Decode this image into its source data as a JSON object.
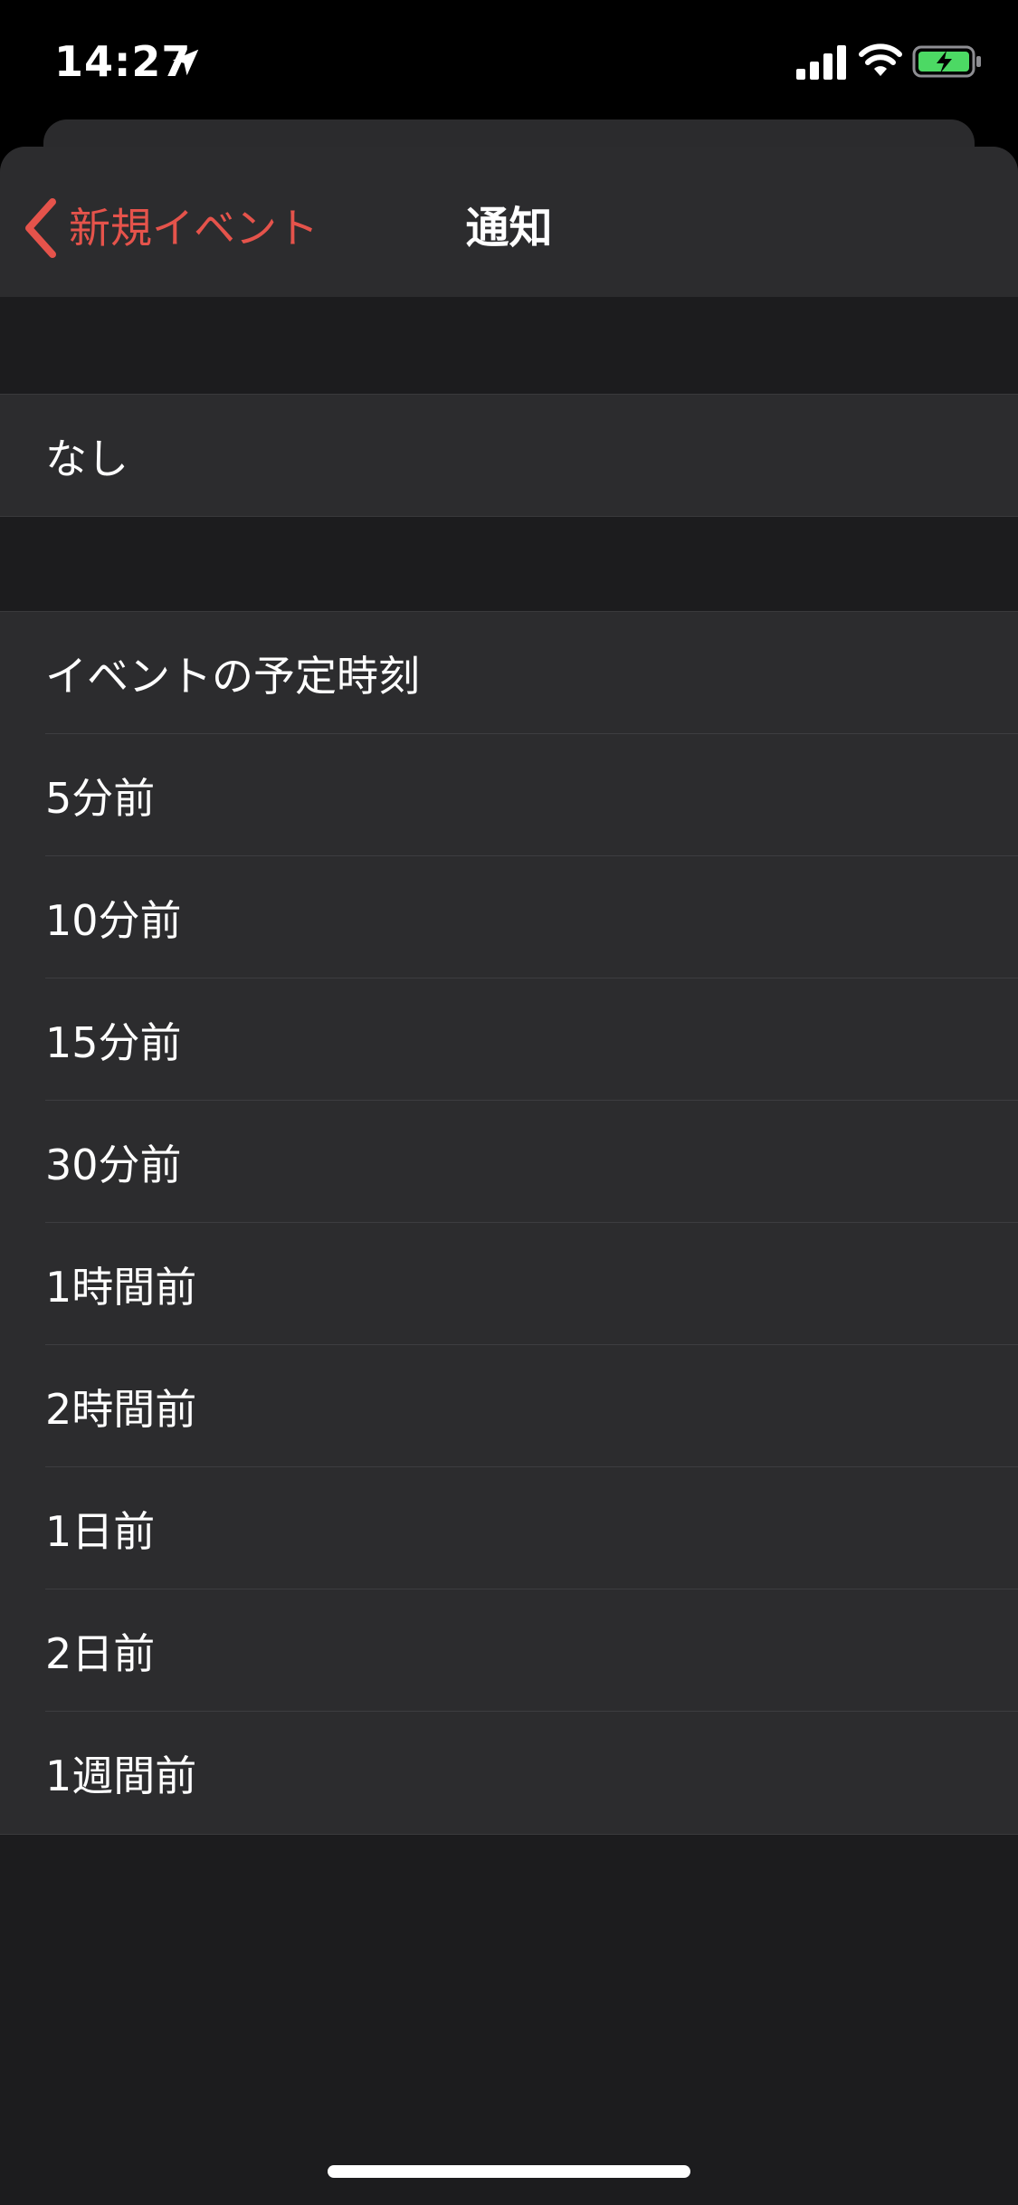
{
  "status_bar": {
    "time": "14:27"
  },
  "nav": {
    "back_label": "新規イベント",
    "title": "通知"
  },
  "options": {
    "none": "なし",
    "alerts": [
      "イベントの予定時刻",
      "5分前",
      "10分前",
      "15分前",
      "30分前",
      "1時間前",
      "2時間前",
      "1日前",
      "2日前",
      "1週間前"
    ]
  },
  "colors": {
    "accent": "#e5534b",
    "background": "#1c1c1e",
    "cell": "#2c2c2e",
    "battery_fill": "#4cd964"
  },
  "icons": {
    "location": "location-arrow-icon",
    "signal": "cellular-signal-icon",
    "wifi": "wifi-icon",
    "battery": "battery-charging-icon",
    "back": "chevron-left-icon"
  }
}
